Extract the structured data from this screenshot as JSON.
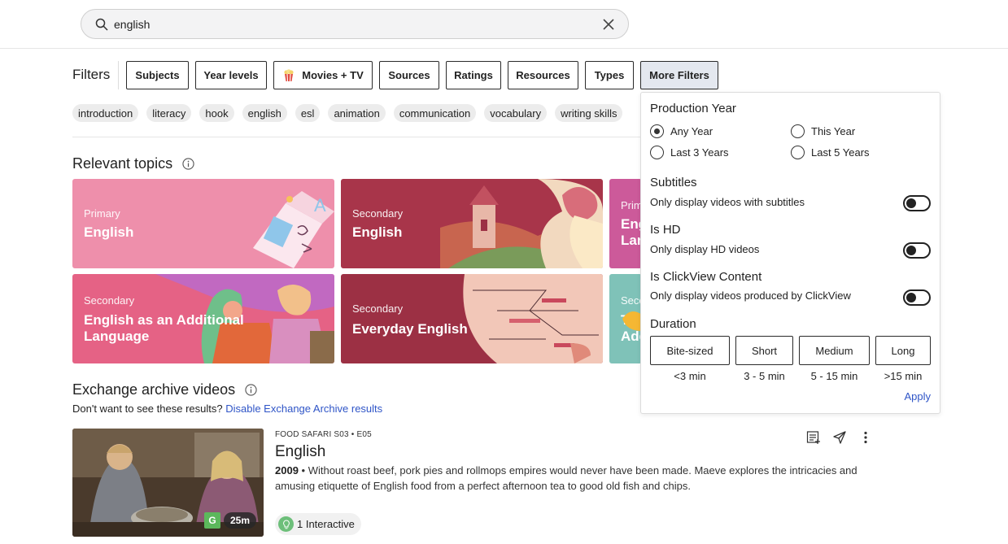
{
  "search": {
    "value": "english",
    "search_icon": "search-icon",
    "clear_icon": "close-icon"
  },
  "filters": {
    "label": "Filters",
    "buttons": [
      {
        "label": "Subjects"
      },
      {
        "label": "Year levels"
      },
      {
        "label": "Movies + TV",
        "icon": "popcorn-icon"
      },
      {
        "label": "Sources"
      },
      {
        "label": "Ratings"
      },
      {
        "label": "Resources"
      },
      {
        "label": "Types"
      },
      {
        "label": "More Filters",
        "active": true
      }
    ]
  },
  "tags": [
    "introduction",
    "literacy",
    "hook",
    "english",
    "esl",
    "animation",
    "communication",
    "vocabulary",
    "writing skills"
  ],
  "relevant_topics": {
    "title": "Relevant topics",
    "cards": [
      {
        "level": "Primary",
        "title": "English",
        "color": "#ee8fab"
      },
      {
        "level": "Secondary",
        "title": "English",
        "color": "#a8354a"
      },
      {
        "level": "Prim",
        "title": "Eng Lan",
        "color": "#cc5a9a"
      },
      {
        "level": "Secondary",
        "title": "English as an Additional Language",
        "color": "#e56285"
      },
      {
        "level": "Secondary",
        "title": "Everyday English",
        "color": "#9c3044"
      },
      {
        "level": "Seco",
        "title": "Tea Add",
        "color": "#7fc2b8"
      }
    ]
  },
  "exchange": {
    "title": "Exchange archive videos",
    "prompt": "Don't want to see these results?",
    "disable_link": "Disable Exchange Archive results"
  },
  "video": {
    "series": "FOOD SAFARI S03 • E05",
    "title": "English",
    "year": "2009",
    "separator": " • ",
    "description": "Without roast beef, pork pies and rollmops empires would never have been made. Maeve explores the intricacies and amusing etiquette of English food from a perfect afternoon tea to good old fish and chips.",
    "rating": "G",
    "duration": "25m",
    "interactive": "1 Interactive"
  },
  "more_filters": {
    "production_year": {
      "heading": "Production Year",
      "options": [
        "Any Year",
        "This Year",
        "Last 3 Years",
        "Last 5 Years"
      ],
      "selected": "Any Year"
    },
    "subtitles": {
      "heading": "Subtitles",
      "desc": "Only display videos with subtitles",
      "on": false
    },
    "hd": {
      "heading": "Is HD",
      "desc": "Only display HD videos",
      "on": false
    },
    "clickview": {
      "heading": "Is ClickView Content",
      "desc": "Only display videos produced by ClickView",
      "on": false
    },
    "duration": {
      "heading": "Duration",
      "options": [
        {
          "label": "Bite-sized",
          "range": "<3 min"
        },
        {
          "label": "Short",
          "range": "3 - 5 min"
        },
        {
          "label": "Medium",
          "range": "5 - 15 min"
        },
        {
          "label": "Long",
          "range": ">15 min"
        }
      ]
    },
    "apply_label": "Apply"
  }
}
